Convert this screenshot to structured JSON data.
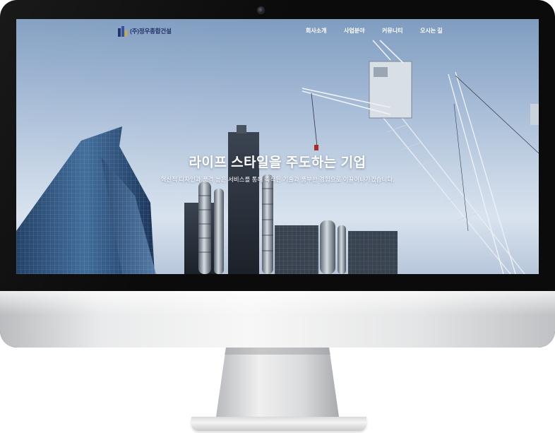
{
  "site": {
    "logo_text": "(주)정우종합건설",
    "nav": [
      {
        "label": "회사소개"
      },
      {
        "label": "사업분야"
      },
      {
        "label": "커뮤니티"
      },
      {
        "label": "오시는 길"
      }
    ]
  },
  "hero": {
    "title": "라이프 스타일을 주도하는 기업",
    "subtitle": "혁신적 디자인과 품격 높은 서비스를 통해 축적된 기술과 풍부한 경험으로 이끌어나가겠습니다."
  },
  "colors": {
    "logo_text": "#1c2e66",
    "sky_top": "#7f9cc0",
    "sky_bottom": "#d9e3ef",
    "bezel": "#0b0b0c"
  }
}
